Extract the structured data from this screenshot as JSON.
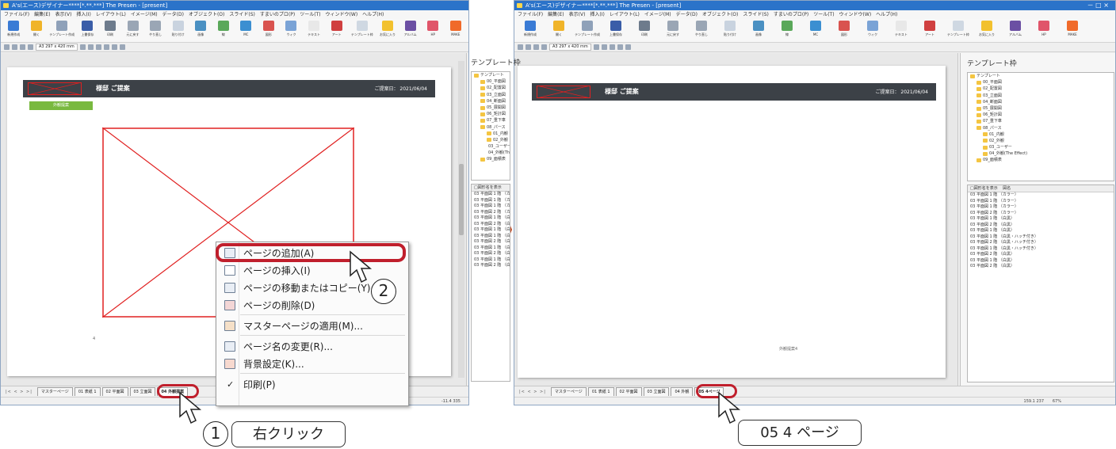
{
  "window": {
    "title": "A's(エース)デザイナー****[*.**.***] The Presen - [present]",
    "controls": "－ □ ×"
  },
  "menu": [
    "ファイル(F)",
    "編集(E)",
    "表示(V)",
    "挿入(I)",
    "レイアウト(L)",
    "イメージ(M)",
    "データ(D)",
    "オブジェクト(O)",
    "スライド(S)",
    "すまいのプロ(P)",
    "ツール(T)",
    "ウィンドウ(W)",
    "ヘルプ(H)"
  ],
  "ribbon": [
    {
      "label": "新規作成",
      "color": "#3a7bd5"
    },
    {
      "label": "開く",
      "color": "#f0b429"
    },
    {
      "label": "テンプレート作成",
      "color": "#8fa1b9"
    },
    {
      "label": "上書保存",
      "color": "#3a5da8"
    },
    {
      "label": "印刷",
      "color": "#6d7b8c"
    },
    {
      "label": "元に戻す",
      "color": "#9aa6b5"
    },
    {
      "label": "やり直し",
      "color": "#9aa6b5"
    },
    {
      "label": "貼り付け",
      "color": "#c9d3df"
    },
    {
      "label": "画像",
      "color": "#4a90c2"
    },
    {
      "label": "線",
      "color": "#5aa85a"
    },
    {
      "label": "MC",
      "color": "#3b8fd1"
    },
    {
      "label": "図形",
      "color": "#d9534f"
    },
    {
      "label": "ウィク",
      "color": "#7aa3d6"
    },
    {
      "label": "テキスト",
      "color": "#e8e8e8"
    },
    {
      "label": "アート",
      "color": "#d04040"
    },
    {
      "label": "テンプレート枠",
      "color": "#cfd8e2"
    },
    {
      "label": "お気に入り",
      "color": "#f2c12e"
    },
    {
      "label": "アルバム",
      "color": "#6b4fa3"
    },
    {
      "label": "HP",
      "color": "#e0556a"
    },
    {
      "label": "MAKE",
      "color": "#f06a2a"
    }
  ],
  "toolbar": {
    "paper_size": "A3 297 x 420 mm"
  },
  "page": {
    "title": "様邸 ご提案",
    "date": "ご提案日： 2021/06/04",
    "green_tag": "外観提案",
    "page_number_left": "4",
    "page_number_right": "外観提案4"
  },
  "tabs_left": {
    "nav": "|< < > >|",
    "items": [
      "マスターページ",
      "01 表紙 1",
      "02 平面図",
      "03 立面図",
      "04 外観提案"
    ]
  },
  "tabs_right": {
    "nav": "|< < > >|",
    "items": [
      "マスターページ",
      "01 表紙 1",
      "02 平面図",
      "03 立面図",
      "04 外観",
      "05 4ページ"
    ]
  },
  "status": {
    "left_coords": "-11.4  335",
    "right_coords": "159.1  237",
    "zoom": "67%"
  },
  "template_panel": {
    "title": "テンプレート枠",
    "tree": [
      "テンプレート",
      "00_平面図",
      "02_配置図",
      "03_立面図",
      "04_断面図",
      "05_展開図",
      "06_矩計図",
      "07_重下車",
      "08_パース",
      "01_内観",
      "02_外観",
      "03_ユーザー",
      "04_外観(The Effect)",
      "09_面積表"
    ],
    "list_header": "□図形名を表示",
    "list_header2": "図名",
    "list_items": [
      "03 平面図 1 階 （カラー）",
      "03 平面図 1 階 （カラー）",
      "03 平面図 1 階 （カラー）",
      "03 平面図 2 階 （カラー）",
      "03 平面図 1 階 （白黒）",
      "03 平面図 2 階 （白黒）",
      "03 平面図 1 階 （白黒）",
      "03 平面図 1 階 （白黒・ハッチ付き）",
      "03 平面図 2 階 （白黒・ハッチ付き）",
      "03 平面図 1 階 （白黒・ハッチ付き）",
      "03 平面図 2 階 （白黒）",
      "03 平面図 1 階 （白黒）",
      "03 平面図 2 階 （白黒）"
    ]
  },
  "context_menu": {
    "items": [
      {
        "label": "ページの追加(A)"
      },
      {
        "label": "ページの挿入(I)"
      },
      {
        "label": "ページの移動またはコピー(Y)..."
      },
      {
        "label": "ページの削除(D)"
      },
      {
        "label": "マスターページの適用(M)..."
      },
      {
        "label": "ページ名の変更(R)..."
      },
      {
        "label": "背景設定(K)..."
      },
      {
        "label": "印刷(P)"
      }
    ]
  },
  "annotations": {
    "step1_num": "1",
    "step1_label": "右クリック",
    "step2_num": "2",
    "result_label": "05 4 ページ"
  },
  "colors": {
    "highlight": "#c01f2c",
    "arrow": "#c0461e",
    "title_bar": "#2b73c9",
    "header_band": "#3c4147",
    "green_tag": "#79b93f",
    "placeholder_lines": "#e02020"
  }
}
